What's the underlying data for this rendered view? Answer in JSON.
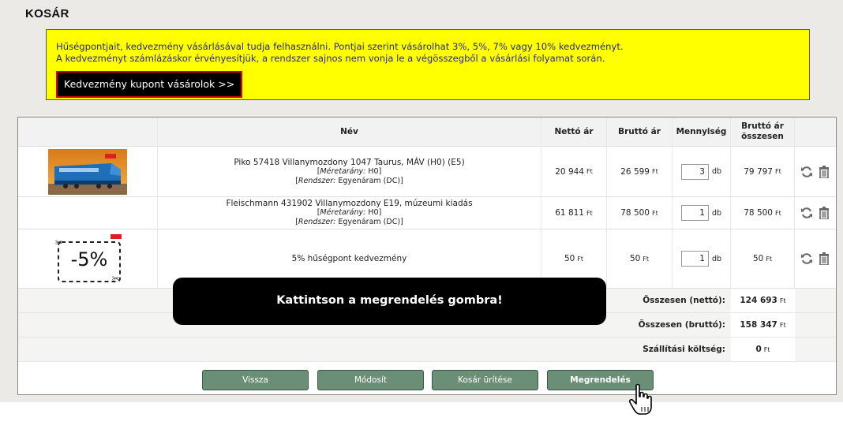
{
  "page": {
    "title": "KOSÁR"
  },
  "notice": {
    "line1": "Hűségpontjait, kedvezmény vásárlásával tudja felhasználni. Pontjai szerint vásárolhat 3%, 5%, 7% vagy 10% kedvezményt.",
    "line2": "A kedvezményt számlázáskor érvényesítjük, a rendszer sajnos nem vonja le a végösszegből a vásárlási folyamat során.",
    "button_label": "Kedvezmény kupont vásárolok >>"
  },
  "table": {
    "headers": {
      "name": "Név",
      "net": "Nettó ár",
      "gross": "Bruttó ár",
      "qty": "Mennyiség",
      "total_line1": "Bruttó ár",
      "total_line2": "összesen"
    },
    "currency": "Ft",
    "unit": "db",
    "scale_label": "Méretarány:",
    "system_label": "Rendszer:",
    "rows": [
      {
        "name": "Piko 57418 Villanymozdony 1047 Taurus, MÁV (H0) (E5)",
        "scale": "H0",
        "system": "Egyenáram (DC)",
        "net": "20 944",
        "gross": "26 599",
        "qty": "3",
        "total": "79 797",
        "image": "locomotive-photo"
      },
      {
        "name": "Fleischmann 431902 Villanymozdony E19, múzeumi kiadás",
        "scale": "H0",
        "system": "Egyenáram (DC)",
        "net": "61 811",
        "gross": "78 500",
        "qty": "1",
        "total": "78 500",
        "image": ""
      },
      {
        "name": "5% hűségpont kedvezmény",
        "net": "50",
        "gross": "50",
        "qty": "1",
        "total": "50",
        "image": "coupon",
        "coupon_text": "-5%"
      }
    ]
  },
  "summary": {
    "net_label": "Összesen (nettó):",
    "net_value": "124 693",
    "gross_label": "Összesen (bruttó):",
    "gross_value": "158 347",
    "shipping_label": "Szállítási költség:",
    "shipping_value": "0"
  },
  "buttons": {
    "back": "Vissza",
    "modify": "Módosít",
    "empty": "Kosár ürítése",
    "order": "Megrendelés"
  },
  "tooltip": {
    "text": "Kattintson a megrendelés gombra!"
  },
  "icons": {
    "refresh": "refresh-icon",
    "delete": "trash-icon",
    "cursor": "hand-pointer-icon"
  },
  "colors": {
    "notice_bg": "#ffff00",
    "button_bg": "#6b8f76",
    "coupon_border": "#e10000"
  }
}
